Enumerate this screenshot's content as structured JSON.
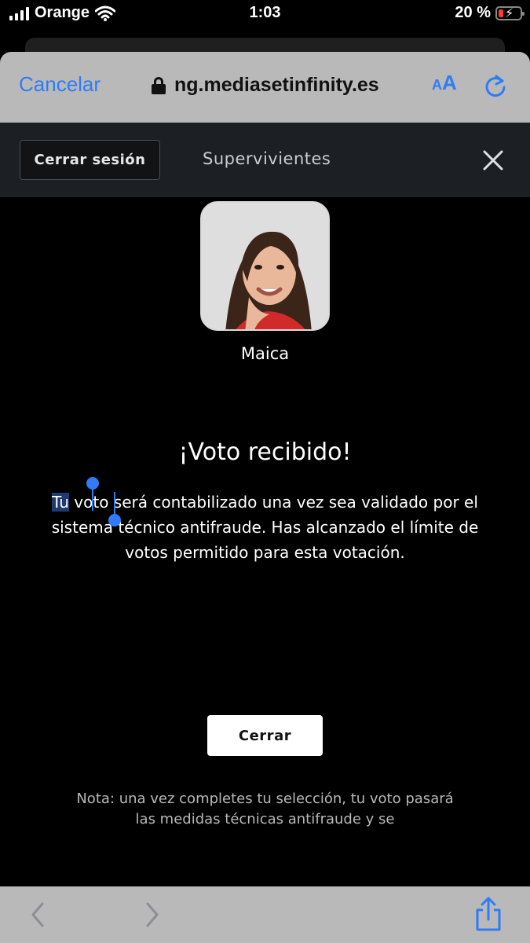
{
  "status_bar": {
    "carrier": "Orange",
    "time": "1:03",
    "battery": "20 %"
  },
  "browser": {
    "cancel_label": "Cancelar",
    "url": "ng.mediasetinfinity.es",
    "text_size_small": "A",
    "text_size_large": "A"
  },
  "site_header": {
    "logout_label": "Cerrar sesión",
    "title": "Supervivientes"
  },
  "contestant": {
    "name": "Maica"
  },
  "confirmation": {
    "heading": "¡Voto recibido!",
    "selected_word": "Tu",
    "body_rest": " voto será contabilizado una vez sea validado por el sistema técnico antifraude. Has alcanzado el límite de votos permitido para esta votación."
  },
  "close_button": "Cerrar",
  "note": "Nota: una vez completes tu selección, tu voto pasará las medidas técnicas antifraude y se",
  "colors": {
    "accent": "#2f7cf6",
    "chrome": "#b9b9b9",
    "site_bar": "#1c2024",
    "battery_low": "#ff3b30"
  }
}
